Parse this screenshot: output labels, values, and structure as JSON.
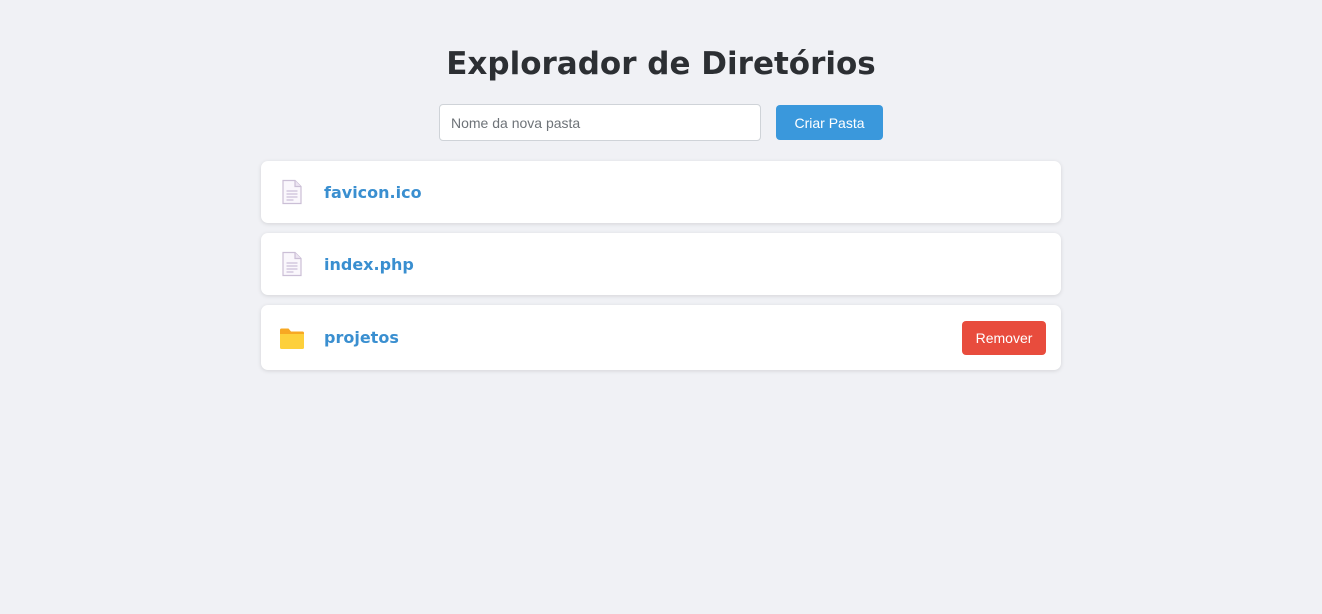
{
  "header": {
    "title": "Explorador de Diretórios"
  },
  "create_form": {
    "input_value": "",
    "input_placeholder": "Nome da nova pasta",
    "button_label": "Criar Pasta"
  },
  "items": [
    {
      "name": "favicon.ico",
      "type": "file",
      "icon": "document-icon"
    },
    {
      "name": "index.php",
      "type": "file",
      "icon": "document-icon"
    },
    {
      "name": "projetos",
      "type": "folder",
      "icon": "folder-icon",
      "action_label": "Remover"
    }
  ],
  "colors": {
    "background": "#f0f1f5",
    "primary": "#3a98dc",
    "link": "#3a8fd0",
    "danger": "#e84c3d",
    "folder": "#fbc02d"
  }
}
